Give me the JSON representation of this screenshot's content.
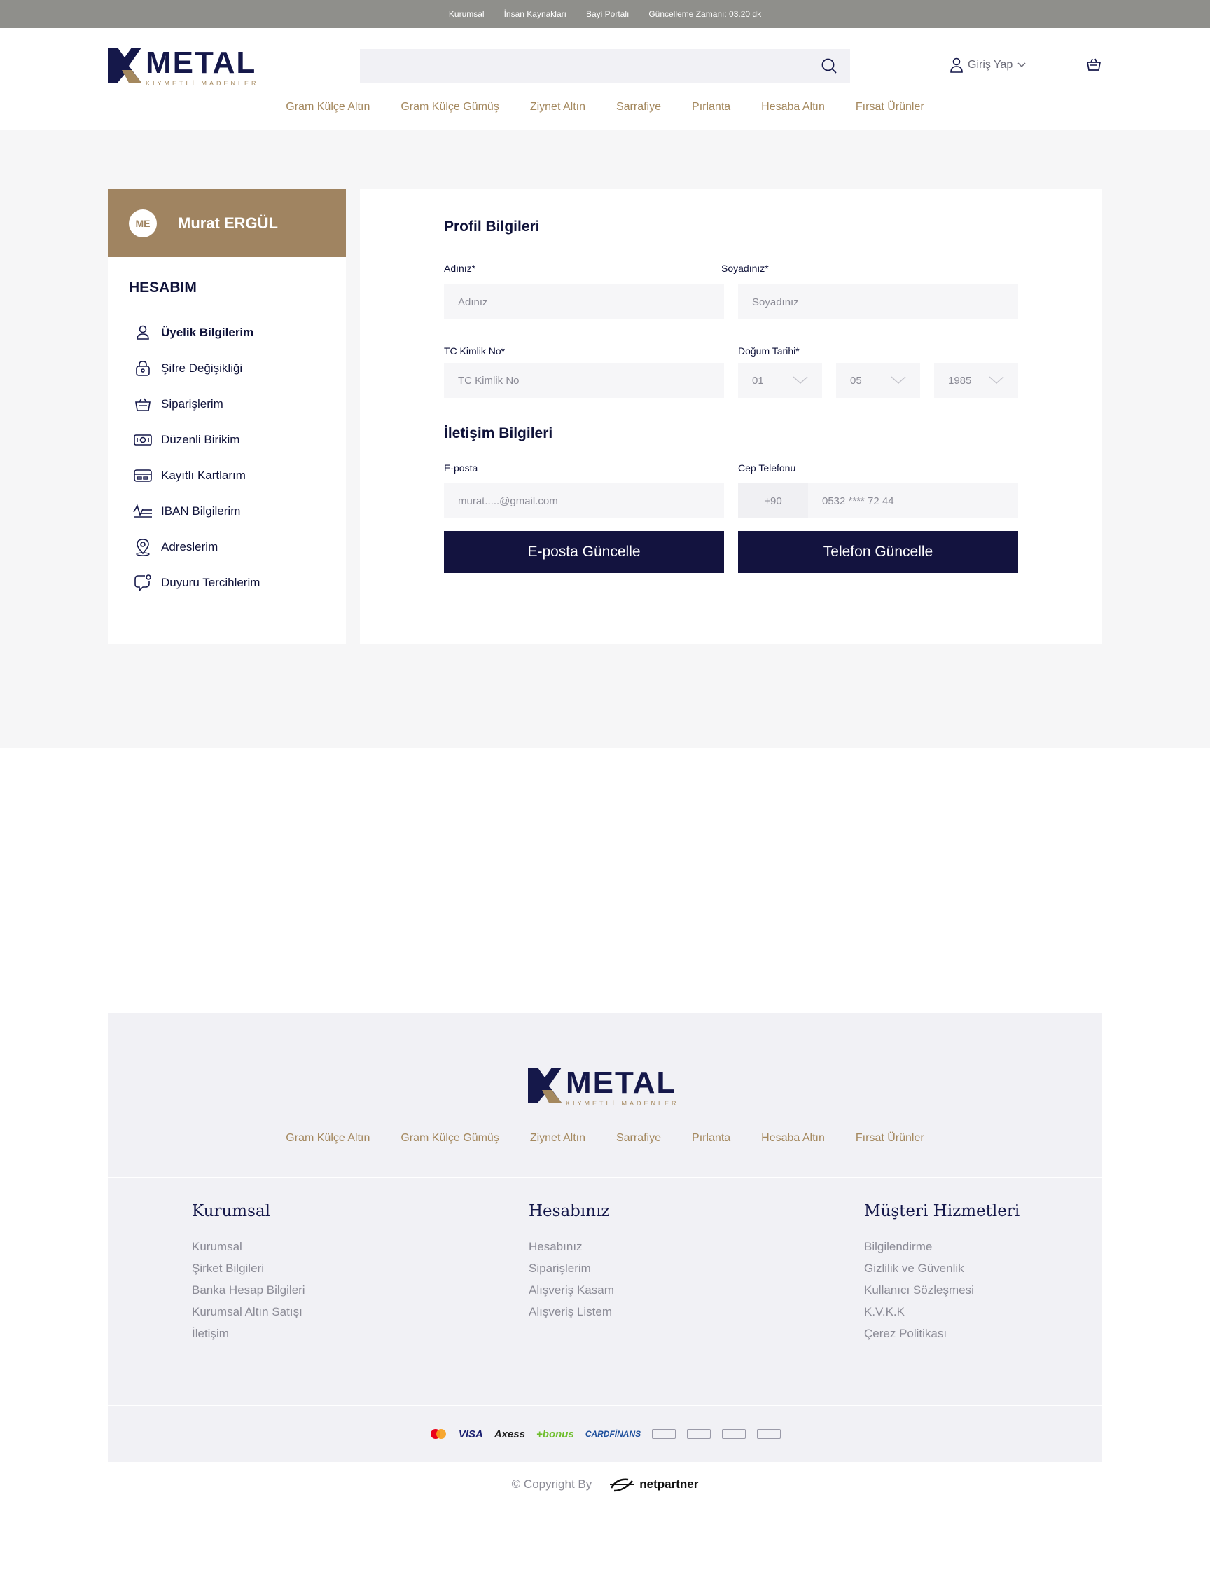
{
  "topbar": {
    "links": [
      "Kurumsal",
      "İnsan Kaynakları",
      "Bayi Portalı",
      "Güncelleme Zamanı: 03.20 dk"
    ]
  },
  "brand": {
    "name": "METAL",
    "tagline": "KIYMETLİ MADENLER",
    "colors": {
      "navy": "#15184a",
      "gold": "#a4885e"
    }
  },
  "header": {
    "search_placeholder": "",
    "login_label": "Giriş Yap",
    "nav": [
      "Gram Külçe Altın",
      "Gram Külçe Gümüş",
      "Ziynet Altın",
      "Sarrafiye",
      "Pırlanta",
      "Hesaba Altın",
      "Fırsat Ürünler"
    ]
  },
  "sidebar": {
    "initials": "ME",
    "user_name": "Murat ERGÜL",
    "heading": "HESABIM",
    "items": [
      {
        "label": "Üyelik Bilgilerim",
        "icon": "user-icon",
        "active": true
      },
      {
        "label": "Şifre Değişikliği",
        "icon": "lock-icon"
      },
      {
        "label": "Siparişlerim",
        "icon": "basket-icon"
      },
      {
        "label": "Düzenli Birikim",
        "icon": "money-icon"
      },
      {
        "label": "Kayıtlı Kartlarım",
        "icon": "card-icon"
      },
      {
        "label": "IBAN Bilgilerim",
        "icon": "iban-icon"
      },
      {
        "label": "Adreslerim",
        "icon": "location-icon"
      },
      {
        "label": "Duyuru Tercihlerim",
        "icon": "chat-notification-icon"
      }
    ]
  },
  "profile": {
    "title": "Profil Bilgileri",
    "first_name_label": "Adınız*",
    "first_name_placeholder": "Adınız",
    "last_name_label": "Soyadınız*",
    "last_name_placeholder": "Soyadınız",
    "tc_label": "TC Kimlik No*",
    "tc_placeholder": "TC Kimlik No",
    "birth_label": "Doğum Tarihi*",
    "birth_day": "01",
    "birth_month": "05",
    "birth_year": "1985"
  },
  "contact": {
    "title": "İletişim Bilgileri",
    "email_label": "E-posta",
    "email_value": "murat.....@gmail.com",
    "phone_label": "Cep Telefonu",
    "phone_prefix": "+90",
    "phone_value": "0532 **** 72 44",
    "email_button": "E-posta Güncelle",
    "phone_button": "Telefon Güncelle"
  },
  "footer": {
    "nav": [
      "Gram Külçe Altın",
      "Gram Külçe Gümüş",
      "Ziynet Altın",
      "Sarrafiye",
      "Pırlanta",
      "Hesaba Altın",
      "Fırsat Ürünler"
    ],
    "columns": [
      {
        "title": "Kurumsal",
        "links": [
          "Kurumsal",
          "Şirket Bilgileri",
          "Banka Hesap Bilgileri",
          "Kurumsal Altın Satışı",
          "İletişim"
        ]
      },
      {
        "title": "Hesabınız",
        "links": [
          "Hesabınız",
          "Siparişlerim",
          "Alışveriş Kasam",
          "Alışveriş Listem"
        ]
      },
      {
        "title": "Müşteri Hizmetleri",
        "links": [
          "Bilgilendirme",
          "Gizlilik ve Güvenlik",
          "Kullanıcı Sözleşmesi",
          "K.V.K.K",
          "Çerez Politikası"
        ]
      }
    ],
    "payments": {
      "visa": "VISA",
      "axess": "Axess",
      "bonus": "+bonus",
      "cardfinans": "CARDFİNANS"
    },
    "copyright": "© Copyright By",
    "partner": "netpartner"
  }
}
